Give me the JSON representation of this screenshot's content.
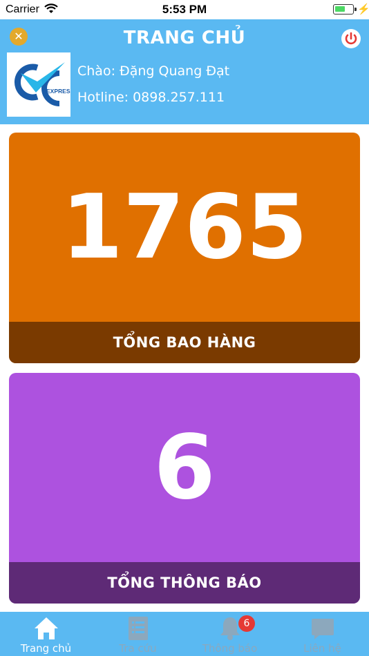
{
  "status_bar": {
    "carrier": "Carrier",
    "time": "5:53 PM"
  },
  "header": {
    "title": "TRANG CHỦ",
    "greeting": "Chào: Đặng Quang Đạt",
    "hotline": "Hotline: 0898.257.111",
    "logo_text": "EXPRESS"
  },
  "cards": [
    {
      "value": "1765",
      "label": "TỔNG BAO HÀNG",
      "color": "#e07000",
      "footer_color": "#7a3a00"
    },
    {
      "value": "6",
      "label": "TỔNG THÔNG BÁO",
      "color": "#ad52df",
      "footer_color": "#5e2a76"
    }
  ],
  "tabs": [
    {
      "label": "Trang chủ",
      "icon": "home-icon",
      "active": true
    },
    {
      "label": "Tra cứu",
      "icon": "document-icon",
      "active": false
    },
    {
      "label": "Thông báo",
      "icon": "bell-icon",
      "active": false,
      "badge": "6"
    },
    {
      "label": "Liên hệ",
      "icon": "chat-icon",
      "active": false
    }
  ],
  "colors": {
    "header": "#5ab9f2",
    "tab_inactive": "#8ca8bd",
    "badge": "#e53935"
  }
}
